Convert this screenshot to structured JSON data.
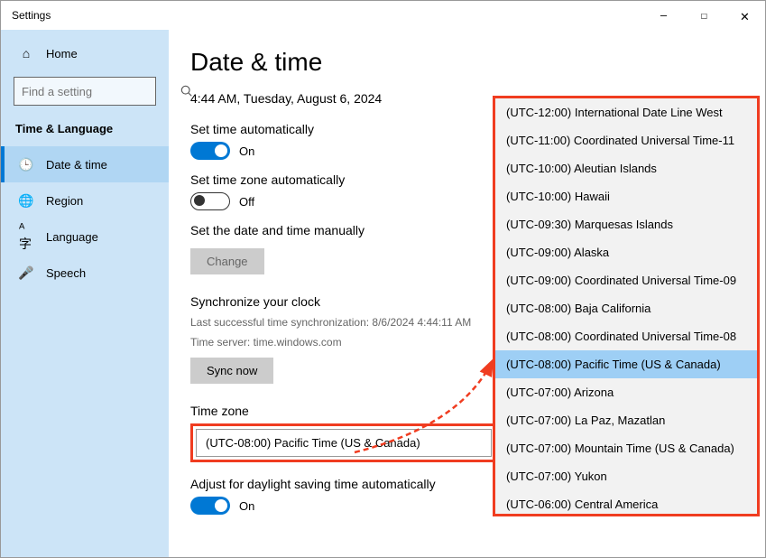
{
  "window": {
    "title": "Settings"
  },
  "titlebar": {
    "min": "—",
    "max": "☐",
    "close": "✕"
  },
  "sidebar": {
    "home": "Home",
    "search_placeholder": "Find a setting",
    "category": "Time & Language",
    "items": [
      {
        "icon": "🕒",
        "label": "Date & time",
        "active": true
      },
      {
        "icon": "🌐",
        "label": "Region"
      },
      {
        "icon": "ᴬ字",
        "label": "Language"
      },
      {
        "icon": "🎤",
        "label": "Speech"
      }
    ]
  },
  "page": {
    "title": "Date & time",
    "now": "4:44 AM, Tuesday, August 6, 2024",
    "set_time_auto": {
      "label": "Set time automatically",
      "state": "On"
    },
    "set_tz_auto": {
      "label": "Set time zone automatically",
      "state": "Off"
    },
    "set_manual": {
      "label": "Set the date and time manually",
      "button": "Change"
    },
    "sync": {
      "label": "Synchronize your clock",
      "last": "Last successful time synchronization: 8/6/2024 4:44:11 AM",
      "server": "Time server: time.windows.com",
      "button": "Sync now"
    },
    "tz": {
      "label": "Time zone",
      "value": "(UTC-08:00) Pacific Time (US & Canada)"
    },
    "dst": {
      "label": "Adjust for daylight saving time automatically",
      "state": "On"
    }
  },
  "dropdown": {
    "items": [
      "(UTC-12:00) International Date Line West",
      "(UTC-11:00) Coordinated Universal Time-11",
      "(UTC-10:00) Aleutian Islands",
      "(UTC-10:00) Hawaii",
      "(UTC-09:30) Marquesas Islands",
      "(UTC-09:00) Alaska",
      "(UTC-09:00) Coordinated Universal Time-09",
      "(UTC-08:00) Baja California",
      "(UTC-08:00) Coordinated Universal Time-08",
      "(UTC-08:00) Pacific Time (US & Canada)",
      "(UTC-07:00) Arizona",
      "(UTC-07:00) La Paz, Mazatlan",
      "(UTC-07:00) Mountain Time (US & Canada)",
      "(UTC-07:00) Yukon",
      "(UTC-06:00) Central America"
    ],
    "selected_index": 9
  }
}
